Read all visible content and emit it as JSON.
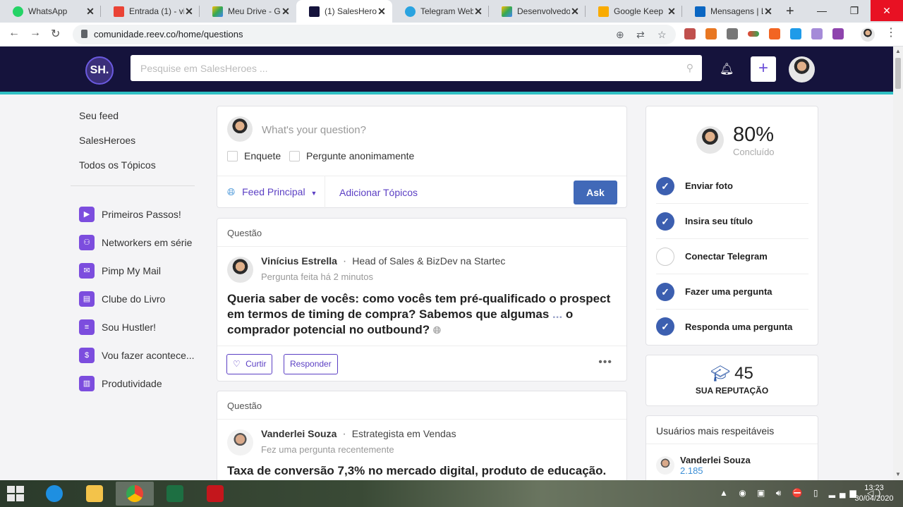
{
  "browser": {
    "tabs": [
      {
        "title": "WhatsApp",
        "color": "#25d366"
      },
      {
        "title": "Entrada (1) - vi",
        "color": "#ea4335"
      },
      {
        "title": "Meu Drive - Go",
        "color": "#fbbc04"
      },
      {
        "title": "(1) SalesHeroes",
        "color": "#15133c"
      },
      {
        "title": "Telegram Web",
        "color": "#2aa3e0"
      },
      {
        "title": "Desenvolvedor",
        "color": "#34a853"
      },
      {
        "title": "Google Keep",
        "color": "#f9ab00"
      },
      {
        "title": "Mensagens | Li",
        "color": "#0a66c2"
      }
    ],
    "url": "comunidade.reev.co/home/questions"
  },
  "header": {
    "logo": "SH.",
    "search_placeholder": "Pesquise em SalesHeroes ..."
  },
  "sidebar": {
    "links": [
      "Seu feed",
      "SalesHeroes",
      "Todos os Tópicos"
    ],
    "topics": [
      {
        "label": "Primeiros Passos!",
        "icon": "play-icon"
      },
      {
        "label": "Networkers em série",
        "icon": "network-icon"
      },
      {
        "label": "Pimp My Mail",
        "icon": "mail-icon"
      },
      {
        "label": "Clube do Livro",
        "icon": "book-icon"
      },
      {
        "label": "Sou Hustler!",
        "icon": "document-icon"
      },
      {
        "label": "Vou fazer acontece...",
        "icon": "dollar-icon"
      },
      {
        "label": "Produtividade",
        "icon": "chart-icon"
      }
    ]
  },
  "ask": {
    "placeholder": "What's your question?",
    "option_poll": "Enquete",
    "option_anon": "Pergunte anonimamente",
    "feed_label": "Feed Principal",
    "add_topics": "Adicionar Tópicos",
    "ask_button": "Ask"
  },
  "questions": [
    {
      "section": "Questão",
      "author": "Vinícius Estrella",
      "role": "Head of Sales & BizDev na Startec",
      "when": "Pergunta feita há 2 minutos",
      "text_start": "Queria saber de vocês: como vocês tem pré-qualificado o prospect em termos de timing de compra? Sabemos que algumas ",
      "text_more": "...",
      "text_end": " o comprador potencial no outbound?",
      "like": "Curtir",
      "reply": "Responder"
    },
    {
      "section": "Questão",
      "author": "Vanderlei Souza",
      "role": "Estrategista em Vendas",
      "when": "Fez uma pergunta recentemente",
      "text": "Taxa de conversão 7,3% no mercado digital, produto de educação."
    }
  ],
  "progress": {
    "percent": "80%",
    "label": "Concluído",
    "steps": [
      {
        "label": "Enviar foto",
        "done": true
      },
      {
        "label": "Insira seu título",
        "done": true
      },
      {
        "label": "Conectar Telegram",
        "done": false
      },
      {
        "label": "Fazer uma pergunta",
        "done": true
      },
      {
        "label": "Responda uma pergunta",
        "done": true
      }
    ]
  },
  "reputation": {
    "value": "45",
    "label": "SUA REPUTAÇÃO"
  },
  "top_users": {
    "title": "Usuários mais respeitáveis",
    "users": [
      {
        "name": "Vanderlei Souza",
        "score": "2.185"
      }
    ]
  },
  "taskbar": {
    "time": "13:23",
    "date": "30/04/2020"
  }
}
